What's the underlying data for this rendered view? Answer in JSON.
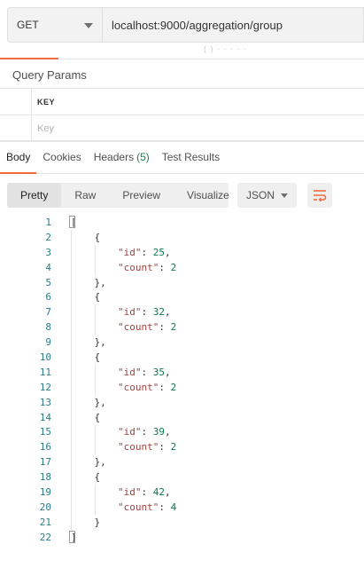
{
  "request": {
    "method": "GET",
    "url": "localhost:9000/aggregation/group"
  },
  "faint_text": "( ) · · · · ·",
  "query_params": {
    "title": "Query Params",
    "header": "KEY",
    "key_placeholder": "Key"
  },
  "response_tabs": [
    {
      "label": "Body"
    },
    {
      "label": "Cookies"
    },
    {
      "label": "Headers",
      "count": "(5)"
    },
    {
      "label": "Test Results"
    }
  ],
  "format_tabs": [
    "Pretty",
    "Raw",
    "Preview",
    "Visualize"
  ],
  "language": "JSON",
  "colors": {
    "accent": "#f26b3a",
    "count_green": "#1a8a4a"
  },
  "icons": {
    "wrap": "wrap-lines-icon",
    "method_caret": "chevron-down-icon"
  },
  "code": {
    "line_numbers": [
      "1",
      "2",
      "3",
      "4",
      "5",
      "6",
      "7",
      "8",
      "9",
      "10",
      "11",
      "12",
      "13",
      "14",
      "15",
      "16",
      "17",
      "18",
      "19",
      "20",
      "21",
      "22"
    ],
    "items": [
      {
        "id": "25",
        "count": "2"
      },
      {
        "id": "32",
        "count": "2"
      },
      {
        "id": "35",
        "count": "2"
      },
      {
        "id": "39",
        "count": "2"
      },
      {
        "id": "42",
        "count": "4"
      }
    ]
  }
}
